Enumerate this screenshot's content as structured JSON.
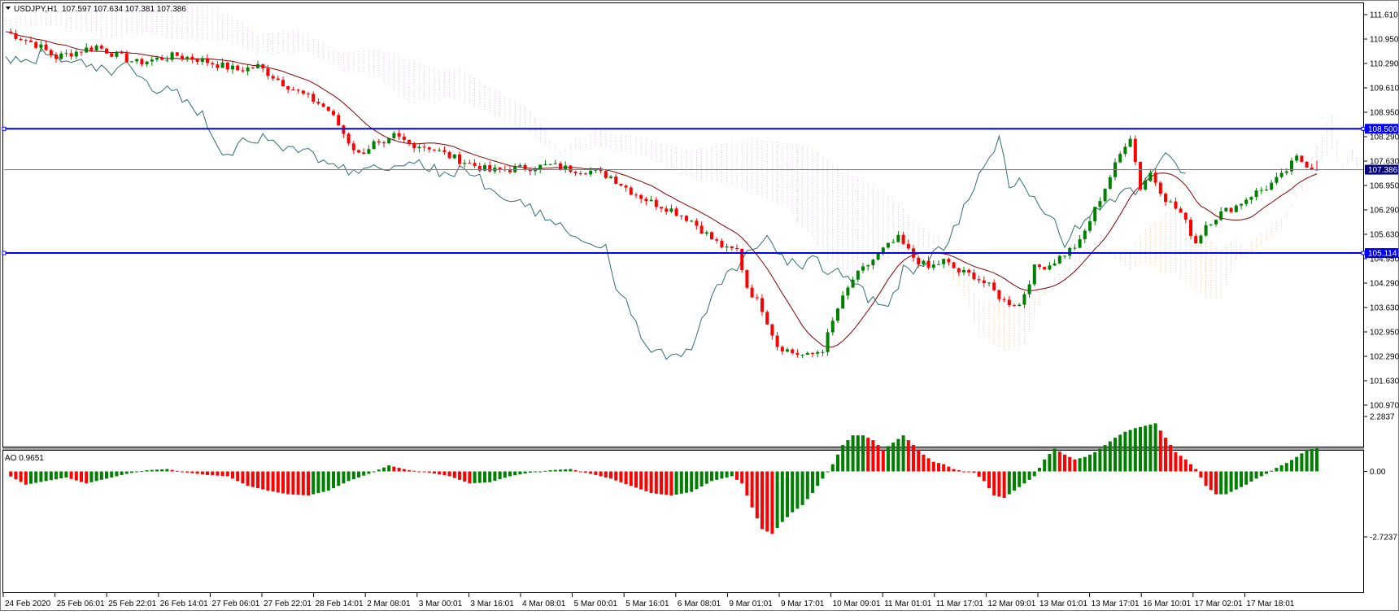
{
  "header": {
    "symbol_text": "USDJPY,H1",
    "ohlc_text": "107.597 107.634 107.381 107.386"
  },
  "indicator": {
    "label": "AO 0.9651"
  },
  "colors": {
    "bull": "#008000",
    "bear": "#ff0000",
    "level_line": "#0000ff",
    "price_line": "#808080",
    "ma": "#8b0000",
    "chikou": "#2f6f6f",
    "cloud_up": "#f4a460",
    "cloud_down": "#c9a0dc"
  },
  "chart_data": [
    {
      "type": "candlestick",
      "title": "USDJPY,H1",
      "symbol": "USDJPY",
      "timeframe": "H1",
      "last_ohlc": {
        "open": 107.597,
        "high": 107.634,
        "low": 107.381,
        "close": 107.386
      },
      "ylim": [
        100.97,
        111.61
      ],
      "y_ticks": [
        "111.610",
        "110.950",
        "110.290",
        "109.610",
        "108.950",
        "108.290",
        "107.630",
        "106.950",
        "106.290",
        "105.630",
        "104.950",
        "104.290",
        "103.630",
        "102.950",
        "102.290",
        "101.630",
        "100.970"
      ],
      "current_price": 107.386,
      "current_price_label": "107.386",
      "horizontal_levels": [
        {
          "value": 108.5,
          "label": "108.500"
        },
        {
          "value": 105.114,
          "label": "105.114"
        }
      ],
      "x_ticks": [
        "24 Feb 2020",
        "25 Feb 06:01",
        "25 Feb 22:01",
        "26 Feb 14:01",
        "27 Feb 06:01",
        "27 Feb 22:01",
        "28 Feb 14:01",
        "2 Mar 08:01",
        "3 Mar 00:01",
        "3 Mar 16:01",
        "4 Mar 08:01",
        "5 Mar 00:01",
        "5 Mar 16:01",
        "6 Mar 08:01",
        "9 Mar 01:01",
        "9 Mar 17:01",
        "10 Mar 09:01",
        "11 Mar 01:01",
        "11 Mar 17:01",
        "12 Mar 09:01",
        "13 Mar 01:01",
        "13 Mar 17:01",
        "16 Mar 10:01",
        "17 Mar 02:01",
        "17 Mar 18:01"
      ],
      "close_path": [
        [
          0,
          111.15
        ],
        [
          6,
          110.8
        ],
        [
          10,
          110.45
        ],
        [
          14,
          110.6
        ],
        [
          18,
          110.75
        ],
        [
          22,
          110.5
        ],
        [
          26,
          110.3
        ],
        [
          30,
          110.4
        ],
        [
          34,
          110.5
        ],
        [
          38,
          110.4
        ],
        [
          42,
          110.25
        ],
        [
          46,
          110.1
        ],
        [
          50,
          110.2
        ],
        [
          55,
          109.75
        ],
        [
          58,
          109.5
        ],
        [
          62,
          109.2
        ],
        [
          64,
          109.0
        ],
        [
          66,
          108.6
        ],
        [
          68,
          108.15
        ],
        [
          70,
          107.8
        ],
        [
          73,
          108.1
        ],
        [
          75,
          108.0
        ],
        [
          77,
          108.3
        ],
        [
          80,
          108.1
        ],
        [
          84,
          108.0
        ],
        [
          88,
          107.75
        ],
        [
          92,
          107.55
        ],
        [
          96,
          107.35
        ],
        [
          100,
          107.4
        ],
        [
          104,
          107.45
        ],
        [
          108,
          107.5
        ],
        [
          112,
          107.4
        ],
        [
          116,
          107.35
        ],
        [
          120,
          107.2
        ],
        [
          124,
          106.8
        ],
        [
          128,
          106.5
        ],
        [
          132,
          106.3
        ],
        [
          136,
          106.0
        ],
        [
          140,
          105.5
        ],
        [
          143,
          105.2
        ],
        [
          145,
          105.2
        ],
        [
          147,
          104.2
        ],
        [
          150,
          103.6
        ],
        [
          153,
          102.6
        ],
        [
          156,
          102.4
        ],
        [
          159,
          102.3
        ],
        [
          162,
          102.5
        ],
        [
          165,
          103.6
        ],
        [
          168,
          104.4
        ],
        [
          171,
          104.8
        ],
        [
          174,
          105.2
        ],
        [
          177,
          105.5
        ],
        [
          180,
          105.0
        ],
        [
          183,
          104.7
        ],
        [
          186,
          104.9
        ],
        [
          189,
          104.6
        ],
        [
          192,
          104.5
        ],
        [
          195,
          104.2
        ],
        [
          198,
          103.8
        ],
        [
          201,
          103.7
        ],
        [
          204,
          104.7
        ],
        [
          207,
          104.8
        ],
        [
          210,
          105.1
        ],
        [
          213,
          105.4
        ],
        [
          216,
          106.3
        ],
        [
          218,
          106.9
        ],
        [
          220,
          107.5
        ],
        [
          222,
          108.1
        ],
        [
          223,
          108.3
        ],
        [
          225,
          106.9
        ],
        [
          227,
          107.3
        ],
        [
          230,
          106.6
        ],
        [
          233,
          106.2
        ],
        [
          236,
          105.4
        ],
        [
          238,
          105.9
        ],
        [
          241,
          106.2
        ],
        [
          244,
          106.4
        ],
        [
          247,
          106.7
        ],
        [
          250,
          106.9
        ],
        [
          253,
          107.2
        ],
        [
          256,
          107.7
        ],
        [
          259,
          107.45
        ],
        [
          260,
          107.386
        ]
      ],
      "total_bars": 260
    },
    {
      "type": "bar",
      "title": "AO 0.9651",
      "name": "AO",
      "last_value": 0.9651,
      "ylim": [
        -2.7237,
        2.2837
      ],
      "y_ticks": [
        "2.2837",
        "0.00",
        "-2.7237"
      ],
      "values_path": [
        [
          0,
          -0.1
        ],
        [
          4,
          -0.55
        ],
        [
          8,
          -0.4
        ],
        [
          12,
          -0.25
        ],
        [
          16,
          -0.5
        ],
        [
          20,
          -0.3
        ],
        [
          24,
          -0.1
        ],
        [
          28,
          0.05
        ],
        [
          32,
          0.1
        ],
        [
          36,
          -0.05
        ],
        [
          40,
          -0.15
        ],
        [
          44,
          -0.2
        ],
        [
          48,
          -0.6
        ],
        [
          52,
          -0.8
        ],
        [
          56,
          -0.95
        ],
        [
          60,
          -1.0
        ],
        [
          64,
          -0.8
        ],
        [
          68,
          -0.4
        ],
        [
          72,
          -0.1
        ],
        [
          76,
          0.25
        ],
        [
          80,
          0.05
        ],
        [
          84,
          -0.05
        ],
        [
          88,
          -0.2
        ],
        [
          92,
          -0.5
        ],
        [
          96,
          -0.45
        ],
        [
          100,
          -0.2
        ],
        [
          104,
          -0.05
        ],
        [
          108,
          0.05
        ],
        [
          112,
          0.1
        ],
        [
          116,
          -0.1
        ],
        [
          120,
          -0.3
        ],
        [
          124,
          -0.6
        ],
        [
          128,
          -0.9
        ],
        [
          132,
          -1.0
        ],
        [
          136,
          -0.85
        ],
        [
          140,
          -0.4
        ],
        [
          144,
          -0.2
        ],
        [
          146,
          -0.5
        ],
        [
          148,
          -1.5
        ],
        [
          150,
          -2.4
        ],
        [
          152,
          -2.6
        ],
        [
          154,
          -2.1
        ],
        [
          156,
          -1.7
        ],
        [
          158,
          -1.4
        ],
        [
          160,
          -0.9
        ],
        [
          162,
          -0.3
        ],
        [
          164,
          0.3
        ],
        [
          166,
          1.1
        ],
        [
          168,
          1.5
        ],
        [
          170,
          1.5
        ],
        [
          172,
          1.3
        ],
        [
          174,
          0.9
        ],
        [
          176,
          1.2
        ],
        [
          178,
          1.5
        ],
        [
          180,
          1.1
        ],
        [
          182,
          0.7
        ],
        [
          184,
          0.4
        ],
        [
          186,
          0.3
        ],
        [
          188,
          0.1
        ],
        [
          190,
          0.0
        ],
        [
          192,
          -0.05
        ],
        [
          194,
          -0.4
        ],
        [
          196,
          -1.0
        ],
        [
          198,
          -1.1
        ],
        [
          200,
          -0.8
        ],
        [
          202,
          -0.5
        ],
        [
          204,
          -0.2
        ],
        [
          206,
          0.5
        ],
        [
          208,
          0.95
        ],
        [
          210,
          0.7
        ],
        [
          212,
          0.5
        ],
        [
          214,
          0.6
        ],
        [
          216,
          0.8
        ],
        [
          218,
          1.1
        ],
        [
          220,
          1.4
        ],
        [
          222,
          1.65
        ],
        [
          224,
          1.8
        ],
        [
          226,
          1.9
        ],
        [
          228,
          2.0
        ],
        [
          230,
          1.4
        ],
        [
          232,
          0.8
        ],
        [
          234,
          0.5
        ],
        [
          236,
          0.1
        ],
        [
          238,
          -0.6
        ],
        [
          240,
          -0.95
        ],
        [
          242,
          -0.95
        ],
        [
          244,
          -0.75
        ],
        [
          246,
          -0.55
        ],
        [
          248,
          -0.3
        ],
        [
          250,
          -0.1
        ],
        [
          252,
          0.15
        ],
        [
          254,
          0.35
        ],
        [
          256,
          0.6
        ],
        [
          258,
          0.9
        ],
        [
          260,
          0.9651
        ]
      ],
      "total_bars": 260
    }
  ]
}
